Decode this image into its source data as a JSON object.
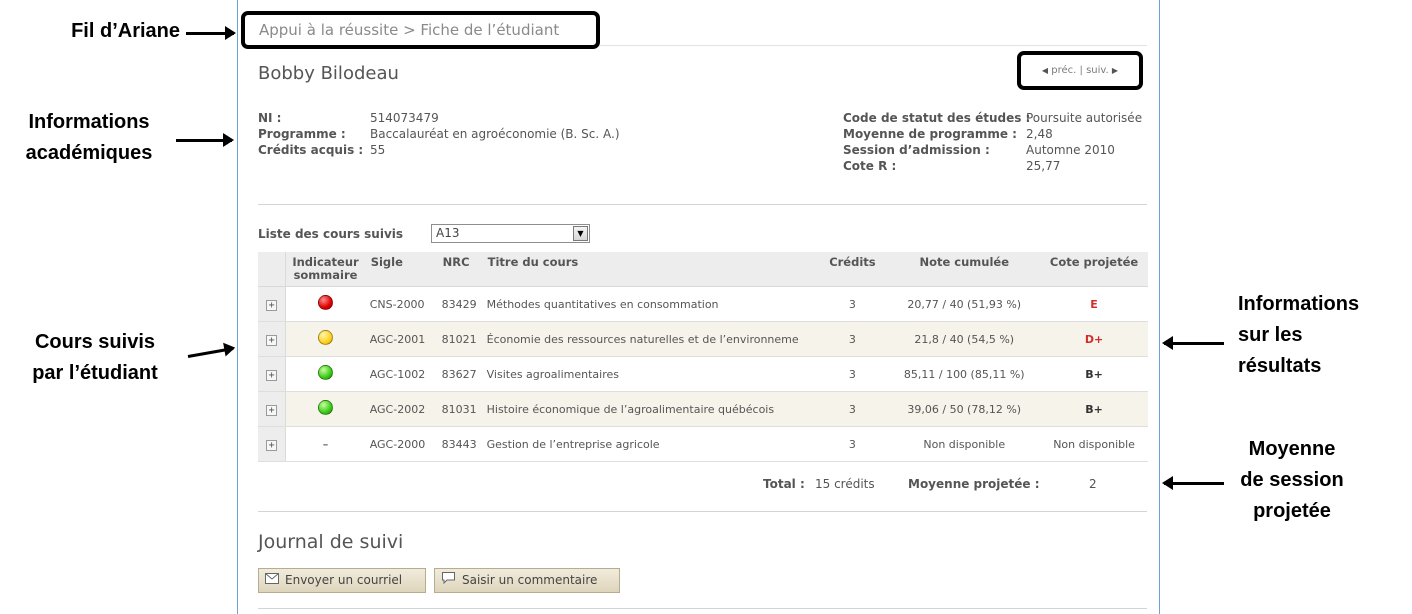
{
  "annotations": {
    "breadcrumb": [
      "Fil d’Ariane"
    ],
    "academic_info": [
      "Informations",
      "académiques"
    ],
    "courses_followed": [
      "Cours suivis",
      "par l’étudiant"
    ],
    "results_info": [
      "Informations",
      "sur les",
      "résultats"
    ],
    "session_average": [
      "Moyenne",
      "de session",
      "projetée"
    ]
  },
  "breadcrumb": "Appui à la réussite > Fiche de l’étudiant",
  "student_name": "Bobby Bilodeau",
  "nav": {
    "prev": "préc.",
    "separator": "|",
    "next": "suiv."
  },
  "academic": {
    "left": [
      {
        "label": "NI :",
        "value": "514073479"
      },
      {
        "label": "Programme :",
        "value": "Baccalauréat en agroéconomie (B. Sc. A.)"
      },
      {
        "label": "Crédits acquis :",
        "value": "55"
      }
    ],
    "right": [
      {
        "label": "Code de statut des études :",
        "value": "Poursuite autorisée"
      },
      {
        "label": "Moyenne de programme :",
        "value": "2,48"
      },
      {
        "label": "Session d’admission :",
        "value": "Automne 2010"
      },
      {
        "label": "Cote R :",
        "value": "25,77"
      }
    ]
  },
  "course_list": {
    "label": "Liste des cours suivis",
    "session": "A13",
    "headers": [
      "Indicateur sommaire",
      "Sigle",
      "NRC",
      "Titre du cours",
      "Crédits",
      "Note cumulée",
      "Cote projetée"
    ],
    "rows": [
      {
        "indicator": "red",
        "sigle": "CNS-2000",
        "nrc": "83429",
        "title": "Méthodes quantitatives en consommation",
        "credits": "3",
        "note": "20,77 / 40 (51,93 %)",
        "cote": "E"
      },
      {
        "indicator": "yellow",
        "sigle": "AGC-2001",
        "nrc": "81021",
        "title": "Économie des ressources naturelles et de l’environneme",
        "credits": "3",
        "note": "21,8 / 40 (54,5 %)",
        "cote": "D+"
      },
      {
        "indicator": "green",
        "sigle": "AGC-1002",
        "nrc": "83627",
        "title": "Visites agroalimentaires",
        "credits": "3",
        "note": "85,11 / 100 (85,11 %)",
        "cote": "B+"
      },
      {
        "indicator": "green",
        "sigle": "AGC-2002",
        "nrc": "81031",
        "title": "Histoire économique de l’agroalimentaire québécois",
        "credits": "3",
        "note": "39,06 / 50 (78,12 %)",
        "cote": "B+"
      },
      {
        "indicator": "none",
        "indicator_text": "–",
        "sigle": "AGC-2000",
        "nrc": "83443",
        "title": "Gestion de l’entreprise agricole",
        "credits": "3",
        "note": "Non disponible",
        "cote": "Non disponible"
      }
    ],
    "expand_symbol": "+",
    "total_label": "Total :",
    "total_value": "15 crédits",
    "average_label": "Moyenne projetée :",
    "average_value": "2"
  },
  "journal": {
    "title": "Journal de suivi",
    "email_button": "Envoyer un courriel",
    "comment_button": "Saisir un commentaire"
  }
}
